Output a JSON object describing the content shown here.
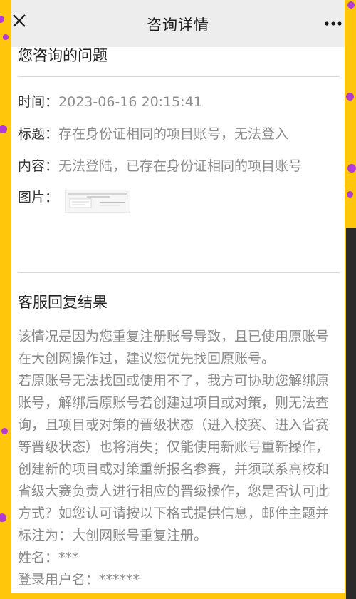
{
  "nav": {
    "title": "咨询详情"
  },
  "question_section": {
    "heading": "您咨询的问题",
    "time_label": "时间：",
    "time_value": "2023-06-16 20:15:41",
    "title_label": "标题：",
    "title_value": "存在身份证相同的项目账号，无法登入",
    "content_label": "内容：",
    "content_value": "无法登陆，已存在身份证相同的项目账号",
    "image_label": "图片："
  },
  "reply_section": {
    "heading": "客服回复结果",
    "paragraph1": "该情况是因为您重复注册账号导致，且已使用原账号在大创网操作过，建议您优先找回原账号。",
    "paragraph2": "若原账号无法找回或使用不了，我方可协助您解绑原账号，解绑后原账号若创建过项目或对策，则无法查询，且项目或对策的晋级状态（进入校赛、进入省赛等晋级状态）也将消失；仅能使用新账号重新操作，创建新的项目或对策重新报名参赛，并须联系高校和省级大赛负责人进行相应的晋级操作，您是否认可此方式？如您认可请按以下格式提供信息，邮件主题并标注为：大创网账号重复注册。",
    "name_line": "姓名：***",
    "username_line": "登录用户名：******"
  },
  "colors": {
    "background": "#ffc60b",
    "dots": "#b43ad6",
    "nav_bg": "#ededed"
  },
  "icons": {
    "close": "close-icon",
    "more": "more-icon"
  }
}
